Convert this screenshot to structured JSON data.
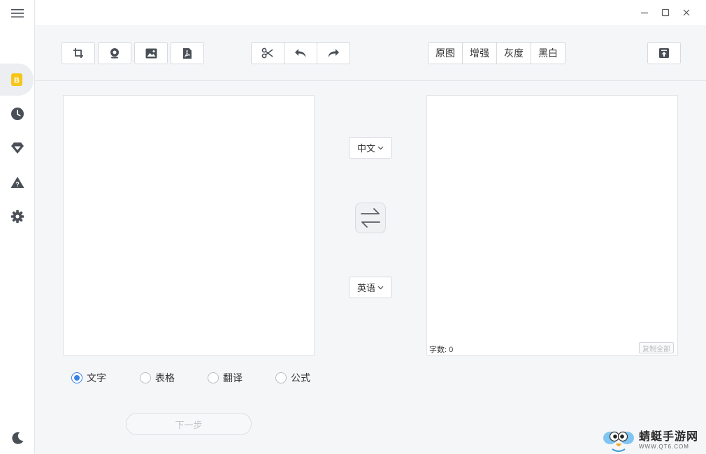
{
  "window": {
    "minimize_icon": "minimize-icon",
    "maximize_icon": "maximize-icon",
    "close_icon": "close-icon"
  },
  "sidebar": {
    "items": [
      {
        "icon": "menu-icon"
      },
      {
        "icon": "ocr-badge-icon",
        "active": true,
        "badge_text": "B"
      },
      {
        "icon": "history-clock-icon"
      },
      {
        "icon": "vip-diamond-icon"
      },
      {
        "icon": "help-warning-icon"
      },
      {
        "icon": "settings-gear-icon"
      },
      {
        "icon": "dark-mode-moon-icon"
      }
    ]
  },
  "toolbar": {
    "input_tools": [
      "screenshot-crop-icon",
      "camera-icon",
      "image-icon",
      "pdf-icon"
    ],
    "edit_tools": [
      "cut-icon",
      "undo-icon",
      "redo-icon"
    ],
    "filters": [
      "原图",
      "增强",
      "灰度",
      "黑白"
    ],
    "export_icon": "export-upload-icon"
  },
  "translate": {
    "source_lang": "中文",
    "target_lang": "英语",
    "swap_icon": "swap-arrows-icon"
  },
  "result": {
    "count_label": "字数: 0",
    "copy_all_label": "复制全部"
  },
  "modes": [
    {
      "label": "文字",
      "selected": true
    },
    {
      "label": "表格",
      "selected": false
    },
    {
      "label": "翻译",
      "selected": false
    },
    {
      "label": "公式",
      "selected": false
    }
  ],
  "next_label": "下一步",
  "watermark": {
    "title": "蜻蜓手游网",
    "url": "WWW.QT6.COM"
  },
  "colors": {
    "accent": "#3a83e5",
    "badge": "#f5c518",
    "icon": "#4a4f57"
  }
}
